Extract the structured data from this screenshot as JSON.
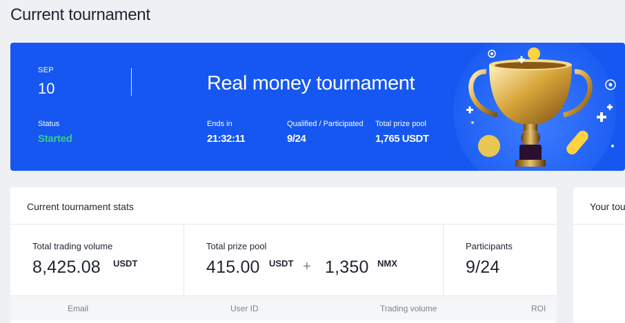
{
  "page": {
    "title": "Current tournament"
  },
  "banner": {
    "month": "SEP",
    "day": "10",
    "status_label": "Status",
    "status_value": "Started",
    "title": "Real money tournament",
    "ends_in_label": "Ends in",
    "ends_in_value": "21:32:11",
    "qualified_label": "Qualified / Participated",
    "qualified_value": "9/24",
    "prize_label": "Total prize pool",
    "prize_value": "1,765 USDT",
    "accent_color": "#1557f0",
    "status_color": "#35d07f",
    "illustration": "trophy-icon"
  },
  "stats": {
    "header": "Current tournament stats",
    "volume_label": "Total trading volume",
    "volume_value": "8,425.08",
    "volume_unit": "USDT",
    "prize_label": "Total prize pool",
    "prize_value_1": "415.00",
    "prize_unit_1": "USDT",
    "plus": "+",
    "prize_value_2": "1,350",
    "prize_unit_2": "NMX",
    "participants_label": "Participants",
    "participants_value": "9/24",
    "columns": [
      "Email",
      "User ID",
      "Trading volume",
      "ROI"
    ]
  },
  "side": {
    "header": "Your tou"
  }
}
